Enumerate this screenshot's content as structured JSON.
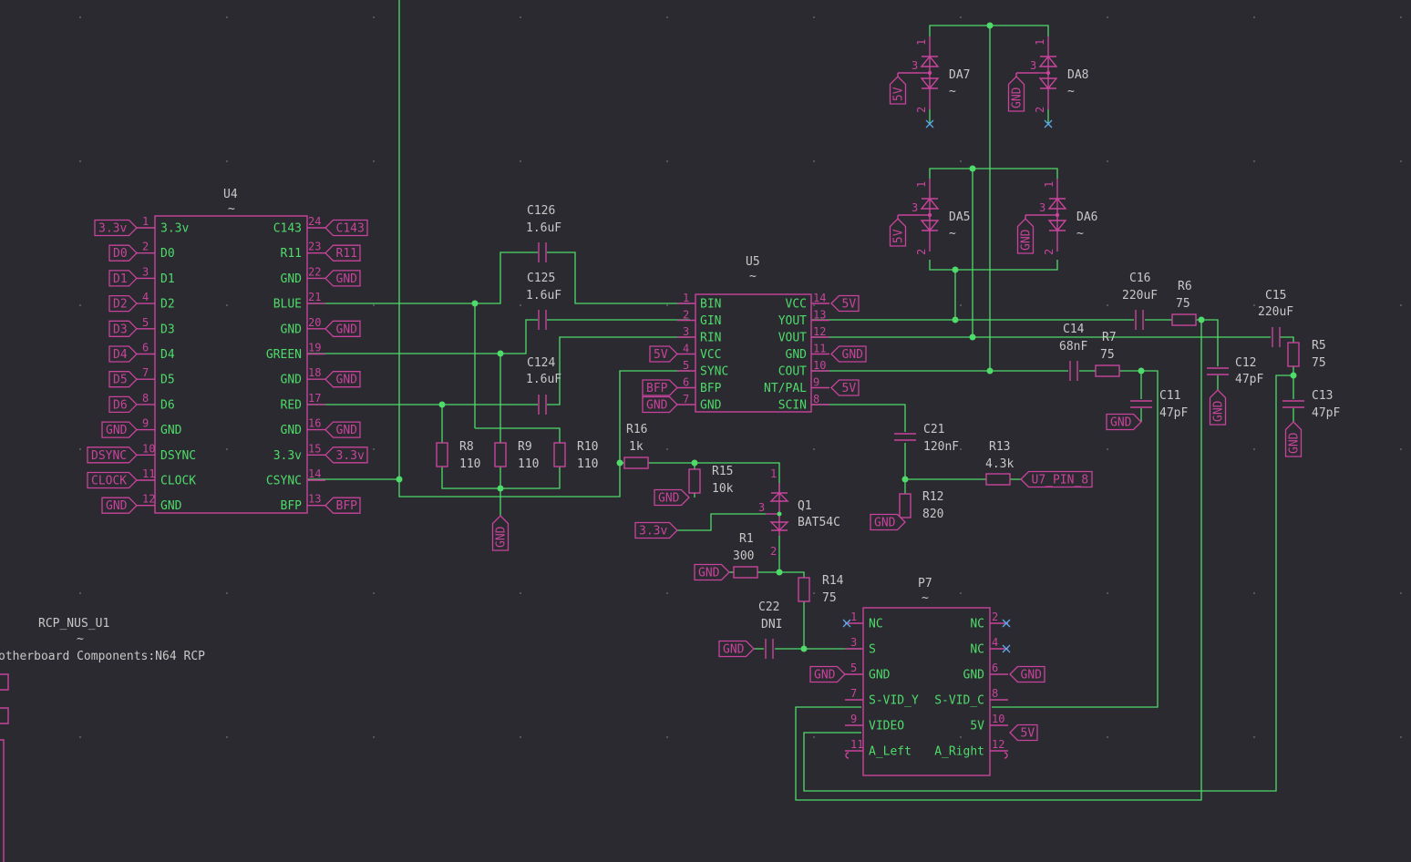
{
  "colors": {
    "wire": "#4fdb6a",
    "body": "#c8449c",
    "text": "#c8c8c8",
    "background": "#2a2a30",
    "nc_marker": "#5aa9e6"
  },
  "U4": {
    "ref": "U4",
    "value": "~",
    "left": [
      [
        "1",
        "3.3v",
        "3.3v"
      ],
      [
        "2",
        "D0",
        "D0"
      ],
      [
        "3",
        "D1",
        "D1"
      ],
      [
        "4",
        "D2",
        "D2"
      ],
      [
        "5",
        "D3",
        "D3"
      ],
      [
        "6",
        "D4",
        "D4"
      ],
      [
        "7",
        "D5",
        "D5"
      ],
      [
        "8",
        "D6",
        "D6"
      ],
      [
        "9",
        "GND",
        "GND"
      ],
      [
        "10",
        "DSYNC",
        "DSYNC"
      ],
      [
        "11",
        "CLOCK",
        "CLOCK"
      ],
      [
        "12",
        "GND",
        "GND"
      ]
    ],
    "right": [
      [
        "24",
        "C143",
        "C143"
      ],
      [
        "23",
        "R11",
        "R11"
      ],
      [
        "22",
        "GND",
        "GND"
      ],
      [
        "21",
        "BLUE",
        ""
      ],
      [
        "20",
        "GND",
        "GND"
      ],
      [
        "19",
        "GREEN",
        ""
      ],
      [
        "18",
        "GND",
        "GND"
      ],
      [
        "17",
        "RED",
        ""
      ],
      [
        "16",
        "GND",
        "GND"
      ],
      [
        "15",
        "3.3v",
        "3.3v"
      ],
      [
        "14",
        "CSYNC",
        ""
      ],
      [
        "13",
        "BFP",
        "BFP"
      ]
    ]
  },
  "U5": {
    "ref": "U5",
    "value": "~",
    "left": [
      [
        "1",
        "BIN",
        ""
      ],
      [
        "2",
        "GIN",
        ""
      ],
      [
        "3",
        "RIN",
        ""
      ],
      [
        "4",
        "VCC",
        "5V"
      ],
      [
        "5",
        "SYNC",
        ""
      ],
      [
        "6",
        "BFP",
        "BFP"
      ],
      [
        "7",
        "GND",
        "GND"
      ]
    ],
    "right": [
      [
        "14",
        "VCC",
        "5V"
      ],
      [
        "13",
        "YOUT",
        ""
      ],
      [
        "12",
        "VOUT",
        ""
      ],
      [
        "11",
        "GND",
        "GND"
      ],
      [
        "10",
        "COUT",
        ""
      ],
      [
        "9",
        "NT/PAL",
        "5V"
      ],
      [
        "8",
        "SCIN",
        ""
      ]
    ]
  },
  "P7": {
    "ref": "P7",
    "value": "~",
    "left": [
      [
        "1",
        "NC"
      ],
      [
        "3",
        "S"
      ],
      [
        "5",
        "GND"
      ],
      [
        "7",
        "S-VID_Y"
      ],
      [
        "9",
        "VIDEO"
      ],
      [
        "11",
        "A_Left"
      ]
    ],
    "right": [
      [
        "2",
        "NC"
      ],
      [
        "4",
        "NC"
      ],
      [
        "6",
        "GND"
      ],
      [
        "8",
        "S-VID_C"
      ],
      [
        "10",
        "5V"
      ],
      [
        "12",
        "A_Right"
      ]
    ],
    "labels": {
      "gnd_left": "GND",
      "gnd_right": "GND",
      "v5": "5V"
    }
  },
  "caps": {
    "C126": {
      "ref": "C126",
      "value": "1.6uF"
    },
    "C125": {
      "ref": "C125",
      "value": "1.6uF"
    },
    "C124": {
      "ref": "C124",
      "value": "1.6uF"
    },
    "C16": {
      "ref": "C16",
      "value": "220uF"
    },
    "C15": {
      "ref": "C15",
      "value": "220uF"
    },
    "C14": {
      "ref": "C14",
      "value": "68nF"
    },
    "C12": {
      "ref": "C12",
      "value": "47pF"
    },
    "C11": {
      "ref": "C11",
      "value": "47pF"
    },
    "C13": {
      "ref": "C13",
      "value": "47pF"
    },
    "C21": {
      "ref": "C21",
      "value": "120nF"
    },
    "C22": {
      "ref": "C22",
      "value": "DNI"
    }
  },
  "res": {
    "R8": {
      "ref": "R8",
      "value": "110"
    },
    "R9": {
      "ref": "R9",
      "value": "110"
    },
    "R10": {
      "ref": "R10",
      "value": "110"
    },
    "R16": {
      "ref": "R16",
      "value": "1k"
    },
    "R15": {
      "ref": "R15",
      "value": "10k"
    },
    "R1": {
      "ref": "R1",
      "value": "300"
    },
    "R14": {
      "ref": "R14",
      "value": "75"
    },
    "R13": {
      "ref": "R13",
      "value": "4.3k"
    },
    "R12": {
      "ref": "R12",
      "value": "820"
    },
    "R6": {
      "ref": "R6",
      "value": "75"
    },
    "R7": {
      "ref": "R7",
      "value": "75"
    },
    "R5": {
      "ref": "R5",
      "value": "75"
    }
  },
  "Q1": {
    "ref": "Q1",
    "value": "BAT54C",
    "pins": [
      "1",
      "2",
      "3"
    ]
  },
  "diodes": {
    "DA7": {
      "ref": "DA7",
      "value": "~"
    },
    "DA8": {
      "ref": "DA8",
      "value": "~"
    },
    "DA5": {
      "ref": "DA5",
      "value": "~"
    },
    "DA6": {
      "ref": "DA6",
      "value": "~"
    },
    "pins": [
      "1",
      "2",
      "3"
    ]
  },
  "labels": {
    "gnd": "GND",
    "v5": "5V",
    "v33": "3.3v",
    "u7pin8": "U7_PIN_8"
  },
  "rcp": {
    "ref": "RCP_NUS_U1",
    "value": "~",
    "footprint": "otherboard Components:N64 RCP"
  }
}
